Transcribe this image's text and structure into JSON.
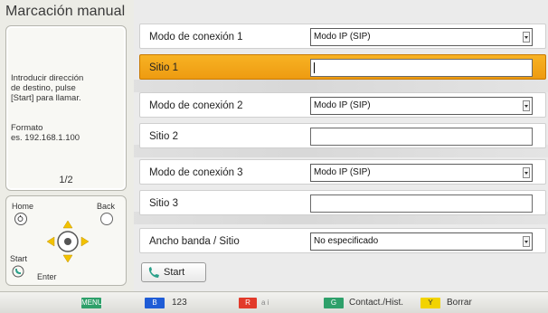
{
  "window": {
    "title": "Marcación manual"
  },
  "info": {
    "instructions": "Introducir dirección\nde destino, pulse\n[Start] para llamar.",
    "format": "Formato\nes. 192.168.1.100",
    "page": "1/2"
  },
  "controls": {
    "home_label": "Home",
    "back_label": "Back",
    "start_label": "Start",
    "enter_label": "Enter"
  },
  "form": {
    "connection_mode_1": {
      "label": "Modo de conexión 1",
      "value": "Modo IP (SIP)"
    },
    "site_1": {
      "label": "Sitio 1",
      "value": ""
    },
    "connection_mode_2": {
      "label": "Modo de conexión 2",
      "value": "Modo IP (SIP)"
    },
    "site_2": {
      "label": "Sitio 2",
      "value": ""
    },
    "connection_mode_3": {
      "label": "Modo de conexión 3",
      "value": "Modo IP (SIP)"
    },
    "site_3": {
      "label": "Sitio 3",
      "value": ""
    },
    "bandwidth": {
      "label": "Ancho banda / Sitio",
      "value": "No especificado"
    },
    "start_button": "Start"
  },
  "bottom_bar": {
    "menu": "MENU",
    "blue_key": "B",
    "blue_text": "123",
    "red_key": "R",
    "red_text": "a i",
    "green_key": "G",
    "green_text": "Contact./Hist.",
    "yellow_key": "Y",
    "yellow_text": "Borrar"
  },
  "colors": {
    "active_row": "#f0a418",
    "menu_key": "#2ea06a",
    "blue_key": "#1f5cd6",
    "red_key": "#e23a2a",
    "green_key": "#2ea06a",
    "yellow_key": "#f2d300",
    "start_icon": "#2aa08a"
  }
}
